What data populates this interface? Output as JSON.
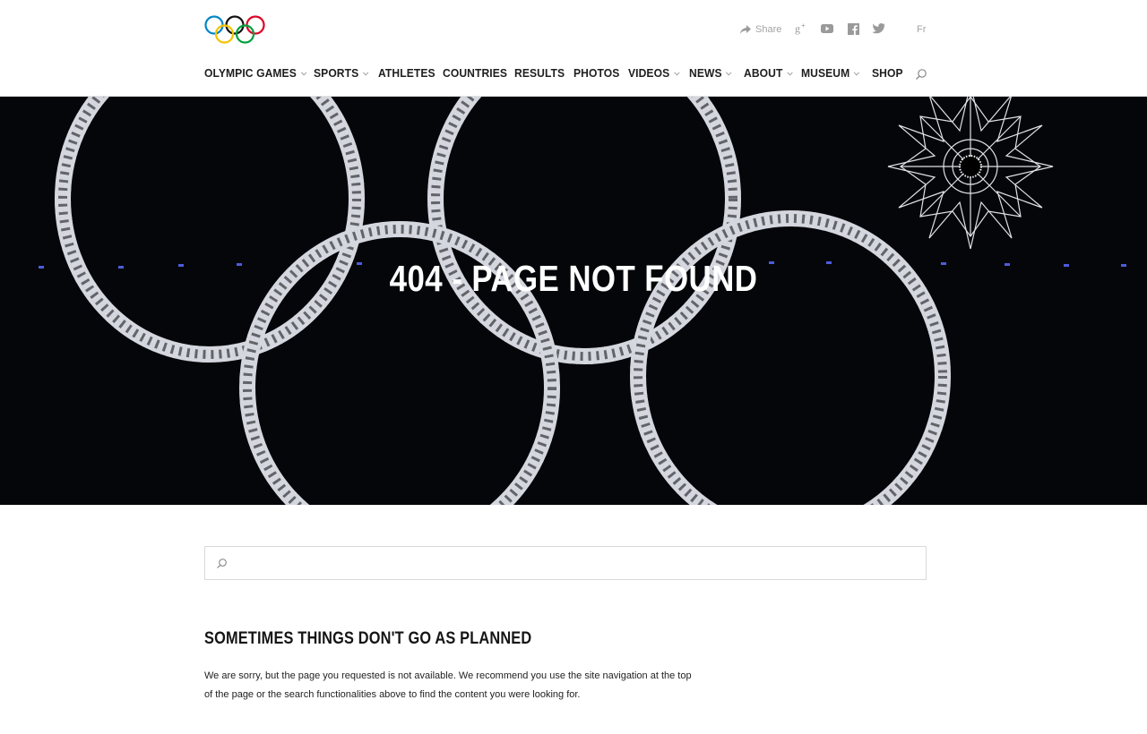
{
  "header": {
    "share_label": "Share",
    "social": [
      "google-plus-icon",
      "youtube-icon",
      "facebook-icon",
      "twitter-icon"
    ],
    "lang_label": "Fr",
    "logo_colors": [
      "#0085c7",
      "#f4c300",
      "#000000",
      "#009f3d",
      "#df0024"
    ]
  },
  "nav": {
    "items": [
      {
        "label": "OLYMPIC GAMES",
        "dropdown": true
      },
      {
        "label": "SPORTS",
        "dropdown": true
      },
      {
        "label": "ATHLETES",
        "dropdown": false
      },
      {
        "label": "COUNTRIES",
        "dropdown": false
      },
      {
        "label": "RESULTS",
        "dropdown": false
      },
      {
        "label": "PHOTOS",
        "dropdown": false
      },
      {
        "label": "VIDEOS",
        "dropdown": true
      },
      {
        "label": "NEWS",
        "dropdown": true
      },
      {
        "label": "ABOUT",
        "dropdown": true
      },
      {
        "label": "MUSEUM",
        "dropdown": true
      },
      {
        "label": "SHOP",
        "dropdown": false
      }
    ]
  },
  "hero": {
    "title": "404 - PAGE NOT FOUND"
  },
  "search": {
    "value": "",
    "placeholder": ""
  },
  "content": {
    "heading": "SOMETIMES THINGS DON'T GO AS PLANNED",
    "body": "We are sorry, but the page you requested is not available. We recommend you use the site navigation at the top of the page or the search functionalities above to find the content you were looking for."
  }
}
